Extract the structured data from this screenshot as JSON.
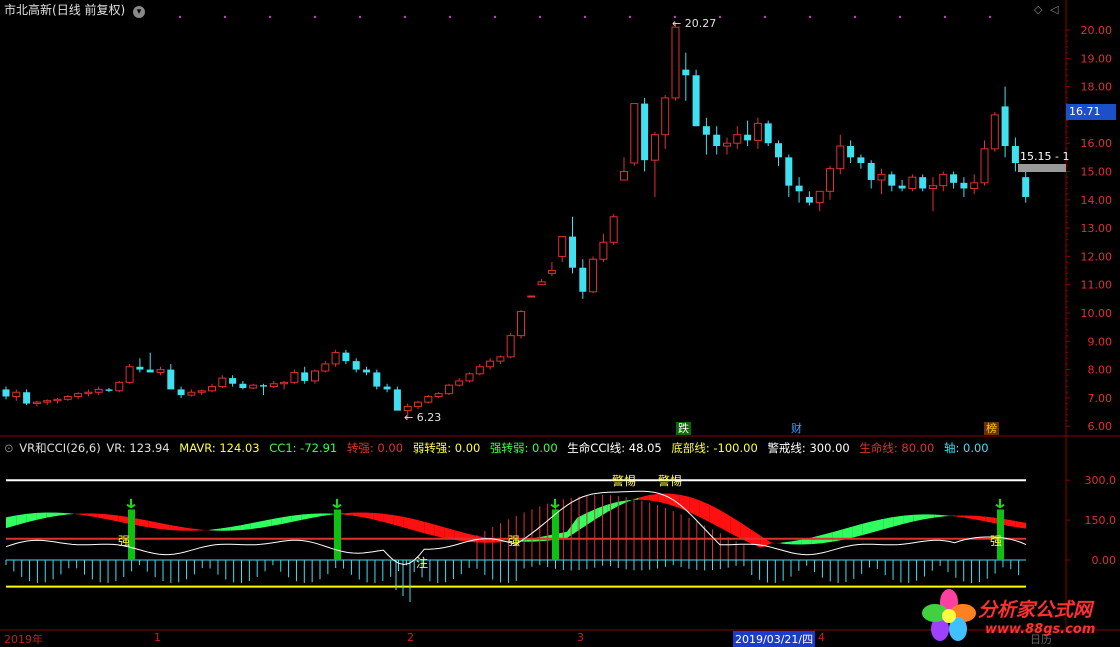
{
  "header": {
    "stock_name": "市北高新",
    "period": "(日线 前复权)",
    "dropdown_icon": "chevron-down-icon"
  },
  "price_axis": {
    "labels": [
      "20.00",
      "19.00",
      "18.00",
      "17.00",
      "16.00",
      "15.00",
      "14.00",
      "13.00",
      "12.00",
      "11.00",
      "10.00",
      "9.00",
      "8.00",
      "7.00",
      "6.00"
    ],
    "current_price": "16.71",
    "current_price_color": "#1a50c8"
  },
  "annotations": {
    "high": "20.27",
    "low": "6.23",
    "level": "15.15 - 1"
  },
  "news_tags": [
    {
      "text": "跌",
      "bg": "#0a6a0a",
      "color": "#ffffff"
    },
    {
      "text": "财",
      "bg": "#000000",
      "color": "#40a0ff"
    },
    {
      "text": "榜",
      "bg": "#6a3000",
      "color": "#ffcc00"
    }
  ],
  "indicator": {
    "name": "VR和CCI(26,6)",
    "vr": "VR: 123.94",
    "mavr": "MAVR: 124.03",
    "cc1": "CC1: -72.91",
    "zhuanqiang": "转强: 0.00",
    "ruozhuanqiang": "弱转强: 0.00",
    "qiangzhuanruo": "强转弱: 0.00",
    "shengming_cci": "生命CCI线: 48.05",
    "dibu": "底部线: -100.00",
    "jingjie": "警戒线: 300.00",
    "shengming": "生命线: 80.00",
    "zhou": "轴: 0.00",
    "axis_labels": [
      "300.0",
      "150.0",
      "0.00"
    ],
    "texts": {
      "qiang": "强",
      "zhu": "注",
      "jingti": "警惕"
    }
  },
  "date_axis": {
    "year": "2019年",
    "months": [
      "1",
      "2",
      "3",
      "4"
    ],
    "selected_date": "2019/03/21/四",
    "right_label": "日历"
  },
  "logo": {
    "text": "分析家公式网",
    "url": "www.88gs.com"
  },
  "colors": {
    "up": "#e03030",
    "down": "#40e0f0",
    "grid": "#8a0000",
    "warning_line": "#ffffff",
    "bottom_line": "#ffff00",
    "life_line": "#e03030"
  },
  "chart_data": {
    "type": "candlestick",
    "note_units": "price in CNY",
    "candles": [
      [
        7.3,
        7.4,
        6.95,
        7.05
      ],
      [
        7.05,
        7.3,
        6.9,
        7.2
      ],
      [
        7.2,
        7.3,
        6.75,
        6.8
      ],
      [
        6.8,
        6.9,
        6.7,
        6.85
      ],
      [
        6.85,
        6.95,
        6.75,
        6.9
      ],
      [
        6.9,
        7.0,
        6.8,
        6.95
      ],
      [
        6.95,
        7.1,
        6.9,
        7.05
      ],
      [
        7.05,
        7.2,
        6.95,
        7.15
      ],
      [
        7.15,
        7.3,
        7.05,
        7.2
      ],
      [
        7.2,
        7.4,
        7.1,
        7.3
      ],
      [
        7.3,
        7.35,
        7.2,
        7.25
      ],
      [
        7.25,
        7.6,
        7.2,
        7.55
      ],
      [
        7.55,
        8.2,
        7.5,
        8.1
      ],
      [
        8.1,
        8.4,
        7.9,
        8.0
      ],
      [
        8.0,
        8.6,
        7.9,
        7.9
      ],
      [
        7.9,
        8.1,
        7.8,
        8.0
      ],
      [
        8.0,
        8.2,
        7.6,
        7.3
      ],
      [
        7.3,
        7.4,
        7.0,
        7.1
      ],
      [
        7.1,
        7.3,
        7.05,
        7.2
      ],
      [
        7.2,
        7.3,
        7.1,
        7.25
      ],
      [
        7.25,
        7.5,
        7.2,
        7.4
      ],
      [
        7.4,
        7.8,
        7.35,
        7.7
      ],
      [
        7.7,
        7.8,
        7.4,
        7.5
      ],
      [
        7.5,
        7.6,
        7.3,
        7.35
      ],
      [
        7.35,
        7.5,
        7.3,
        7.45
      ],
      [
        7.45,
        7.5,
        7.1,
        7.4
      ],
      [
        7.4,
        7.6,
        7.35,
        7.5
      ],
      [
        7.5,
        7.6,
        7.3,
        7.55
      ],
      [
        7.55,
        8.0,
        7.5,
        7.9
      ],
      [
        7.9,
        8.1,
        7.5,
        7.6
      ],
      [
        7.6,
        8.0,
        7.5,
        7.95
      ],
      [
        7.95,
        8.3,
        7.9,
        8.2
      ],
      [
        8.2,
        8.7,
        8.1,
        8.6
      ],
      [
        8.6,
        8.7,
        8.2,
        8.3
      ],
      [
        8.3,
        8.4,
        7.9,
        8.0
      ],
      [
        8.0,
        8.1,
        7.8,
        7.9
      ],
      [
        7.9,
        8.0,
        7.3,
        7.4
      ],
      [
        7.4,
        7.5,
        7.2,
        7.3
      ],
      [
        7.3,
        7.4,
        6.8,
        6.55
      ],
      [
        6.55,
        6.8,
        6.23,
        6.7
      ],
      [
        6.7,
        6.9,
        6.6,
        6.85
      ],
      [
        6.85,
        7.1,
        6.8,
        7.05
      ],
      [
        7.05,
        7.2,
        7.0,
        7.15
      ],
      [
        7.15,
        7.5,
        7.1,
        7.45
      ],
      [
        7.45,
        7.7,
        7.4,
        7.6
      ],
      [
        7.6,
        7.9,
        7.55,
        7.85
      ],
      [
        7.85,
        8.2,
        7.8,
        8.1
      ],
      [
        8.1,
        8.4,
        8.0,
        8.3
      ],
      [
        8.3,
        8.5,
        8.2,
        8.45
      ],
      [
        8.45,
        9.3,
        8.4,
        9.2
      ],
      [
        9.2,
        10.1,
        9.1,
        10.05
      ],
      [
        10.6,
        10.6,
        10.6,
        10.6
      ],
      [
        11.0,
        11.2,
        11.0,
        11.1
      ],
      [
        11.4,
        11.8,
        11.3,
        11.5
      ],
      [
        12.0,
        12.7,
        11.8,
        12.7
      ],
      [
        12.7,
        13.4,
        11.4,
        11.6
      ],
      [
        11.6,
        11.9,
        10.5,
        10.75
      ],
      [
        10.75,
        12.0,
        10.7,
        11.9
      ],
      [
        11.9,
        12.8,
        11.8,
        12.5
      ],
      [
        12.5,
        13.5,
        12.4,
        13.4
      ],
      [
        14.7,
        15.5,
        14.7,
        15.0
      ],
      [
        15.3,
        17.4,
        15.2,
        17.4
      ],
      [
        17.4,
        17.6,
        15.0,
        15.4
      ],
      [
        15.4,
        16.4,
        14.1,
        16.3
      ],
      [
        16.3,
        17.7,
        15.8,
        17.6
      ],
      [
        17.6,
        20.27,
        17.5,
        20.1
      ],
      [
        18.6,
        19.2,
        17.5,
        18.4
      ],
      [
        18.4,
        18.6,
        16.6,
        16.6
      ],
      [
        16.6,
        16.9,
        15.6,
        16.3
      ],
      [
        16.3,
        16.6,
        15.6,
        15.9
      ],
      [
        15.9,
        16.2,
        15.6,
        16.0
      ],
      [
        16.0,
        16.6,
        15.8,
        16.3
      ],
      [
        16.3,
        16.8,
        15.9,
        16.1
      ],
      [
        16.1,
        16.9,
        15.8,
        16.7
      ],
      [
        16.7,
        16.8,
        15.9,
        16.0
      ],
      [
        16.0,
        16.1,
        15.2,
        15.5
      ],
      [
        15.5,
        15.6,
        14.1,
        14.5
      ],
      [
        14.5,
        14.8,
        13.9,
        14.3
      ],
      [
        14.1,
        14.3,
        13.8,
        13.9
      ],
      [
        13.9,
        14.3,
        13.6,
        14.3
      ],
      [
        14.3,
        15.2,
        14.0,
        15.1
      ],
      [
        15.1,
        16.3,
        14.9,
        15.9
      ],
      [
        15.9,
        16.1,
        15.3,
        15.5
      ],
      [
        15.5,
        15.6,
        15.1,
        15.3
      ],
      [
        15.3,
        15.4,
        14.4,
        14.7
      ],
      [
        14.7,
        15.1,
        14.2,
        14.9
      ],
      [
        14.9,
        15.0,
        14.3,
        14.5
      ],
      [
        14.5,
        14.7,
        14.3,
        14.4
      ],
      [
        14.4,
        14.9,
        14.3,
        14.8
      ],
      [
        14.8,
        14.9,
        14.3,
        14.4
      ],
      [
        14.4,
        14.8,
        13.6,
        14.5
      ],
      [
        14.5,
        15.0,
        14.3,
        14.9
      ],
      [
        14.9,
        15.0,
        14.4,
        14.6
      ],
      [
        14.6,
        14.8,
        14.1,
        14.4
      ],
      [
        14.4,
        14.9,
        14.2,
        14.6
      ],
      [
        14.6,
        16.1,
        14.5,
        15.8
      ],
      [
        15.8,
        17.1,
        15.7,
        17.0
      ],
      [
        17.3,
        18.0,
        15.5,
        15.9
      ],
      [
        15.9,
        16.2,
        15.0,
        15.3
      ],
      [
        14.8,
        15.0,
        13.9,
        14.1
      ]
    ]
  }
}
